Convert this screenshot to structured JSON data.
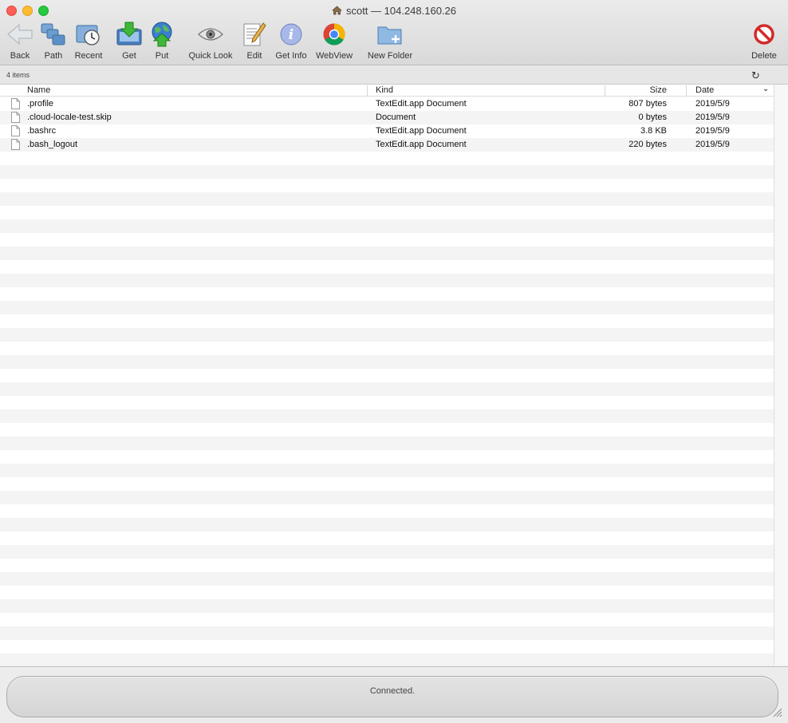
{
  "window": {
    "title": "scott — 104.248.160.26"
  },
  "toolbar": {
    "items": [
      {
        "id": "back",
        "label": "Back"
      },
      {
        "id": "path",
        "label": "Path"
      },
      {
        "id": "recent",
        "label": "Recent"
      },
      {
        "id": "get",
        "label": "Get"
      },
      {
        "id": "put",
        "label": "Put"
      },
      {
        "id": "quicklook",
        "label": "Quick Look"
      },
      {
        "id": "edit",
        "label": "Edit"
      },
      {
        "id": "getinfo",
        "label": "Get Info"
      },
      {
        "id": "webview",
        "label": "WebView"
      },
      {
        "id": "newfolder",
        "label": "New Folder"
      },
      {
        "id": "delete",
        "label": "Delete"
      }
    ]
  },
  "infobar": {
    "count": "4 items",
    "refresh_icon": "refresh-icon"
  },
  "columns": {
    "name": "Name",
    "kind": "Kind",
    "size": "Size",
    "date": "Date"
  },
  "files": [
    {
      "name": ".profile",
      "kind": "TextEdit.app Document",
      "size": "807 bytes",
      "date": "2019/5/9"
    },
    {
      "name": ".cloud-locale-test.skip",
      "kind": "Document",
      "size": "0 bytes",
      "date": "2019/5/9"
    },
    {
      "name": ".bashrc",
      "kind": "TextEdit.app Document",
      "size": "3.8 KB",
      "date": "2019/5/9"
    },
    {
      "name": ".bash_logout",
      "kind": "TextEdit.app Document",
      "size": "220 bytes",
      "date": "2019/5/9"
    }
  ],
  "status": {
    "text": "Connected."
  },
  "colors": {
    "close": "#fd5f57",
    "minimize": "#febc2e",
    "zoom": "#28c840",
    "row_stripe": "#f4f4f4"
  }
}
